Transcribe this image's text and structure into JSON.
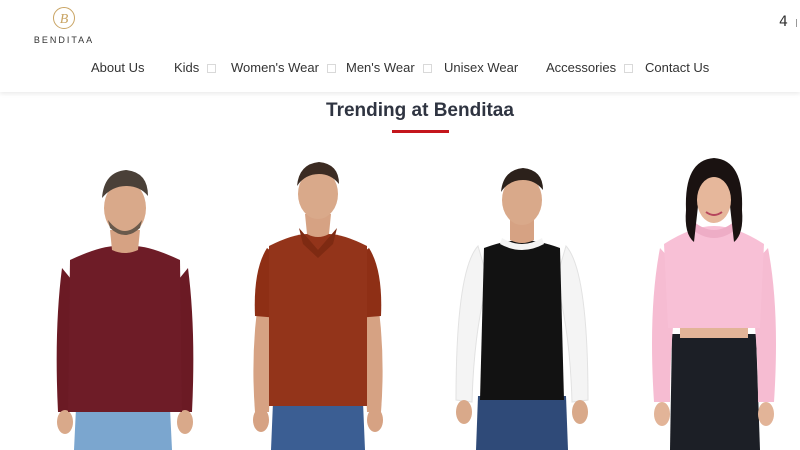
{
  "brand": {
    "logo_letter": "B",
    "name": "BENDITAA"
  },
  "header": {
    "cart_count": "4"
  },
  "nav": {
    "items": [
      {
        "label": "About Us",
        "has_dropdown": false
      },
      {
        "label": "Kids",
        "has_dropdown": true
      },
      {
        "label": "Women's Wear",
        "has_dropdown": true
      },
      {
        "label": "Men's Wear",
        "has_dropdown": true
      },
      {
        "label": "Unisex Wear",
        "has_dropdown": false
      },
      {
        "label": "Accessories",
        "has_dropdown": true
      },
      {
        "label": "Contact Us",
        "has_dropdown": false
      }
    ]
  },
  "section": {
    "title": "Trending at Benditaa"
  },
  "colors": {
    "accent": "#c4161c",
    "title": "#2f3441",
    "logo_gold": "#c9a463"
  },
  "products": [
    {
      "image": "model-maroon-full-sleeve-tshirt"
    },
    {
      "image": "model-rust-polo-tshirt"
    },
    {
      "image": "model-black-white-raglan-tshirt"
    },
    {
      "image": "model-pink-crop-hoodie"
    }
  ]
}
